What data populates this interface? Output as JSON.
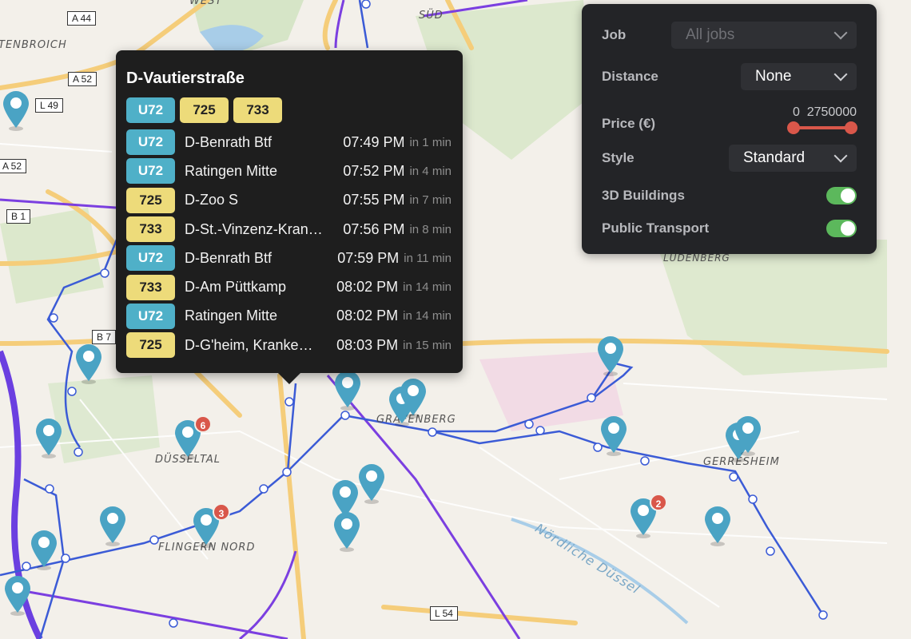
{
  "map": {
    "labels": [
      {
        "name": "area-label-west",
        "text": "WEST"
      },
      {
        "name": "area-label-sud",
        "text": "SÜD"
      },
      {
        "name": "area-label-tenbroich",
        "text": "TENBROICH"
      },
      {
        "name": "area-label-grafenberg",
        "text": "GRAFENBERG"
      },
      {
        "name": "area-label-gerresheim",
        "text": "GERRESHEIM"
      },
      {
        "name": "area-label-dusseltal",
        "text": "DÜSSELTAL"
      },
      {
        "name": "area-label-flingern-nord",
        "text": "FLINGERN NORD"
      },
      {
        "name": "area-label-ludenberg",
        "text": "LUDENBERG"
      },
      {
        "name": "river-label",
        "text": "Nördliche Düssel"
      }
    ],
    "road_shields": [
      "A 44",
      "A 52",
      "L 49",
      "A 52",
      "B 1",
      "B 7",
      "L 54"
    ],
    "pin_badges": [
      "6",
      "3",
      "2"
    ],
    "colors": {
      "pin": "#4aa3c4",
      "tram_line": "#3b5bd6",
      "rail_line": "#7b3fe0",
      "badge": "#d9574a"
    }
  },
  "popup": {
    "title": "D-Vautierstraße",
    "lines": [
      "U72",
      "725",
      "733"
    ],
    "departures": [
      {
        "line": "U72",
        "dest": "D-Benrath Btf",
        "time": "07:49 PM",
        "in": "in 1 min"
      },
      {
        "line": "U72",
        "dest": "Ratingen Mitte",
        "time": "07:52 PM",
        "in": "in 4 min"
      },
      {
        "line": "725",
        "dest": "D-Zoo S",
        "time": "07:55 PM",
        "in": "in 7 min"
      },
      {
        "line": "733",
        "dest": "D-St.-Vinzenz-Kran…",
        "time": "07:56 PM",
        "in": "in 8 min"
      },
      {
        "line": "U72",
        "dest": "D-Benrath Btf",
        "time": "07:59 PM",
        "in": "in 11 min"
      },
      {
        "line": "733",
        "dest": "D-Am Püttkamp",
        "time": "08:02 PM",
        "in": "in 14 min"
      },
      {
        "line": "U72",
        "dest": "Ratingen Mitte",
        "time": "08:02 PM",
        "in": "in 14 min"
      },
      {
        "line": "725",
        "dest": "D-G'heim, Kranke…",
        "time": "08:03 PM",
        "in": "in 15 min"
      }
    ]
  },
  "settings": {
    "job_label": "Job",
    "job_value": "All jobs",
    "distance_label": "Distance",
    "distance_value": "None",
    "price_label": "Price (€)",
    "price_min": "0",
    "price_max": "2750000",
    "style_label": "Style",
    "style_value": "Standard",
    "buildings_label": "3D Buildings",
    "buildings_on": true,
    "transport_label": "Public Transport",
    "transport_on": true
  }
}
